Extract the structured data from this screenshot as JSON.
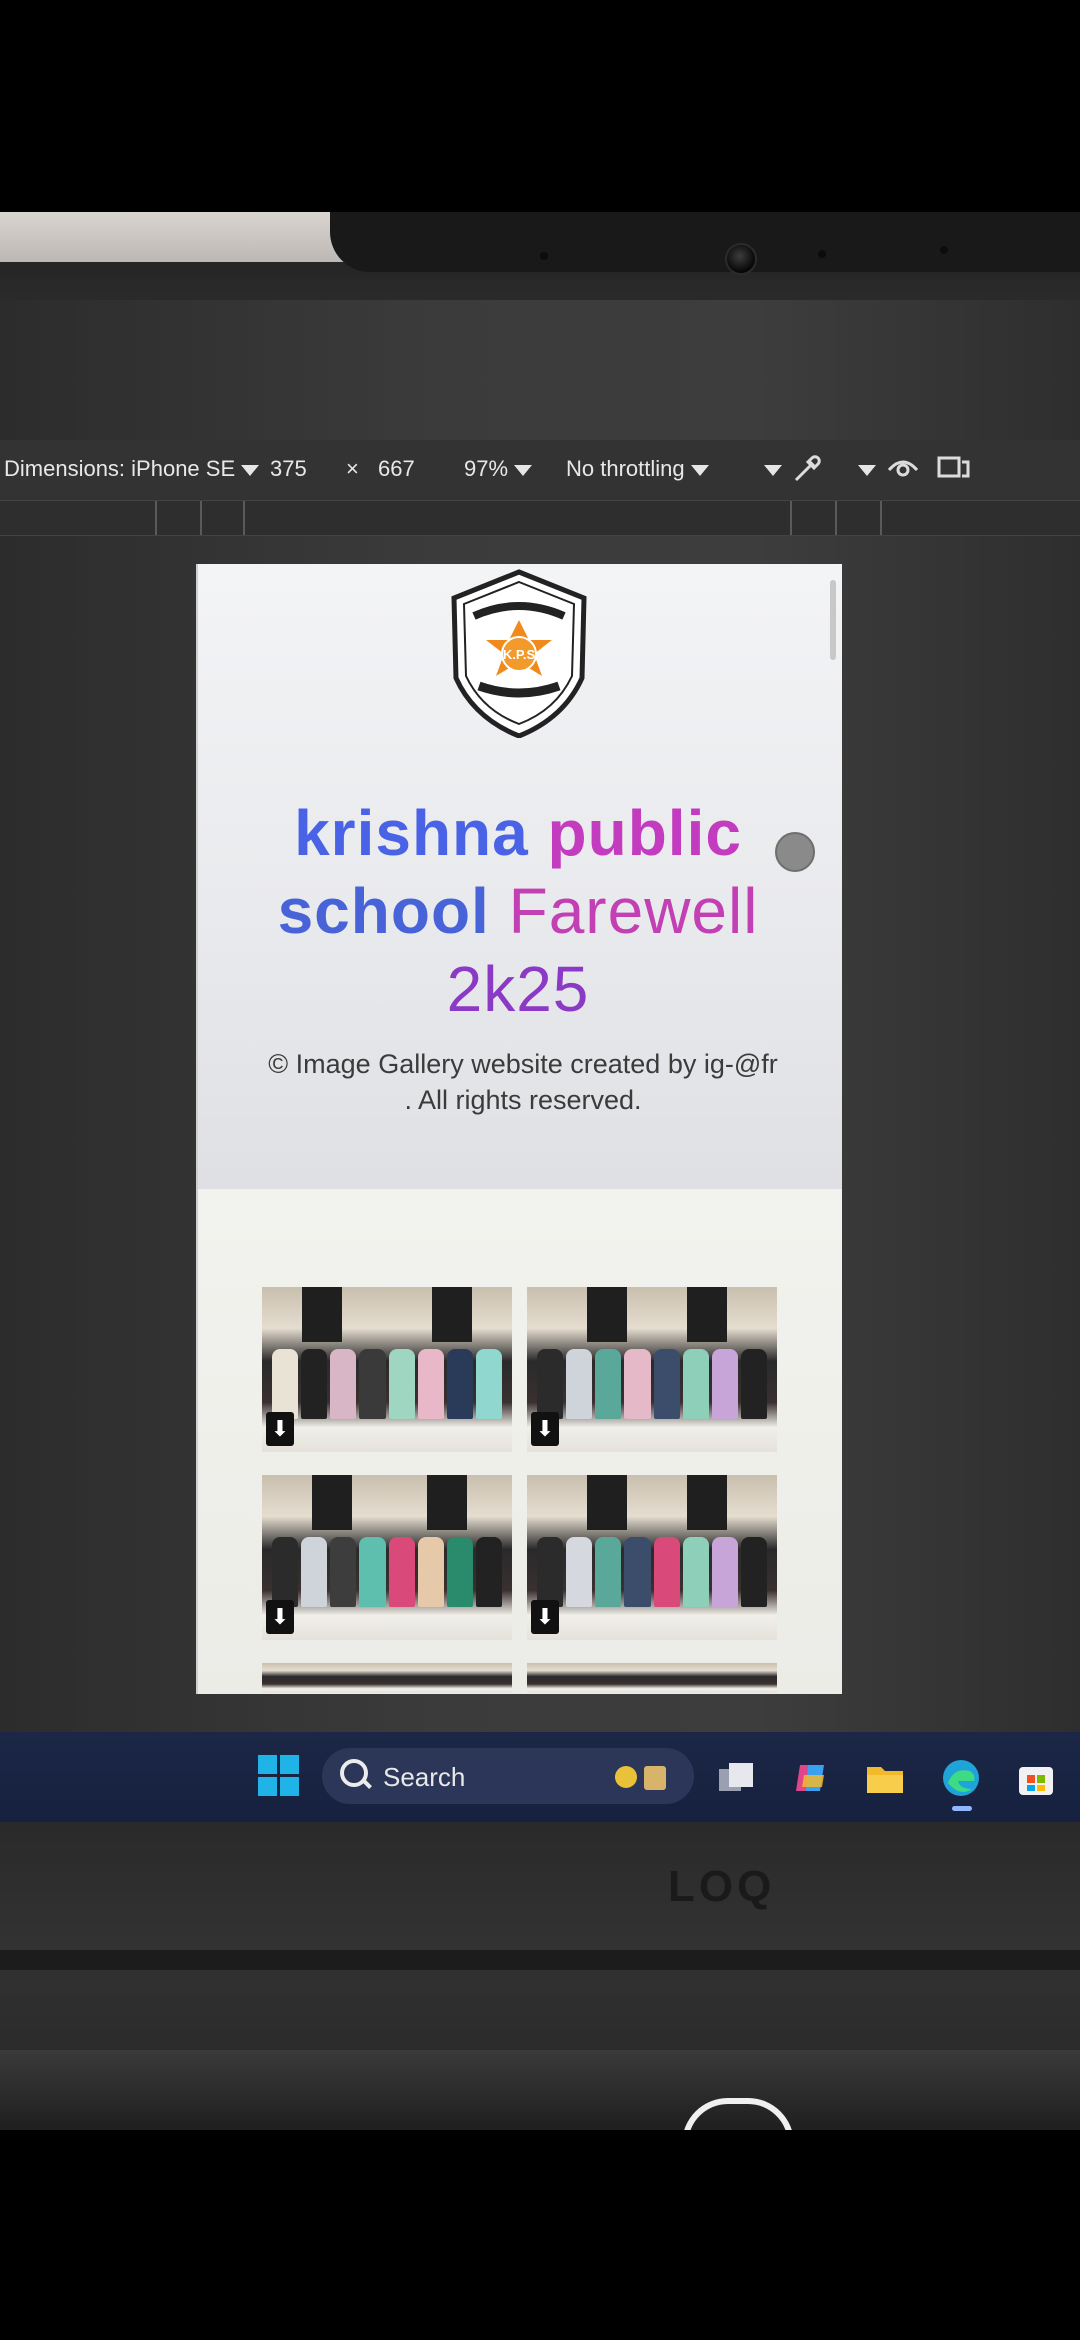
{
  "devtools": {
    "dimensions_label": "Dimensions: iPhone SE",
    "width": "375",
    "times": "×",
    "height": "667",
    "zoom": "97%",
    "throttling": "No throttling"
  },
  "page": {
    "title_words": [
      "krishna",
      "public",
      "school",
      "Farewell",
      "2k25"
    ],
    "copyright_line1": "© Image Gallery website created by ig-@fr",
    "copyright_line2": ". All rights reserved.",
    "logo_text": "K.P.S"
  },
  "gallery": {
    "download_glyph": "⬇"
  },
  "taskbar": {
    "search_label": "Search"
  },
  "laptop": {
    "brand": "LOQ"
  },
  "colors": {
    "title_blue": "#4a63e6",
    "title_magenta": "#c33bbf",
    "title_purple": "#8a3ac4",
    "taskbar": "#1c2646"
  }
}
